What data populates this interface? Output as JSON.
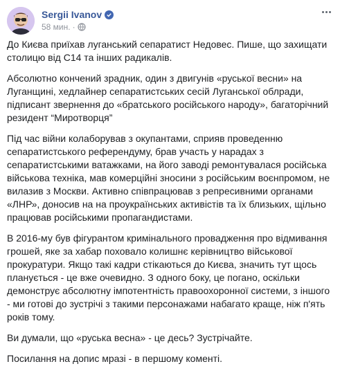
{
  "post": {
    "author": "Sergii Ivanov",
    "verified_icon": "verified-badge-icon",
    "timestamp": "58 мин.",
    "audience_icon": "globe-icon",
    "paragraphs": [
      "До Києва приїхав луганський сепаратист Недовес. Пише, що захищати столицю від С14 та інших радикалів.",
      "Абсолютно кончений зрадник, один з двигунів «руської весни» на Луганщині, хедлайнер сепаратистських сесій Луганської облради, підписант звернення до «братського російського народу», багаторічний резидент “Миротворця”",
      "Під час війни колаборував з окупантами, сприяв проведенню сепаратистського референдуму, брав участь у нарадах з сепаратистськими ватажками, на його заводі ремонтувалася російська військова техніка, мав комерційні зносини з російським воєнпромом, не вилазив з Москви. Активно співпрацював з репресивними органами «ЛНР», доносив на на проукраїнських активістів та їх близьких, щільно працював російськими пропагандистами.",
      "В 2016-му був фігурантом кримінального провадження про відмивання грошей, яке за хабар поховало колишнє керівництво військової прокуратури. Якщо такі кадри стікаються до Києва, значить тут щось планується - це вже очевидно. З одного боку, це погано, оскільки демонструє абсолютну імпотентність правоохоронної системи, з іншого - ми готові до зустрічі з такими персонажами набагато краще, ніж п'ять років тому.",
      "Ви думали, що «руська весна» - це десь? Зустрічайте.",
      "Посилання на допис мразі - в першому коменті."
    ]
  },
  "colors": {
    "author_link": "#385898",
    "meta_gray": "#90949c",
    "text": "#1c1e21",
    "verified": "#4267b2"
  }
}
